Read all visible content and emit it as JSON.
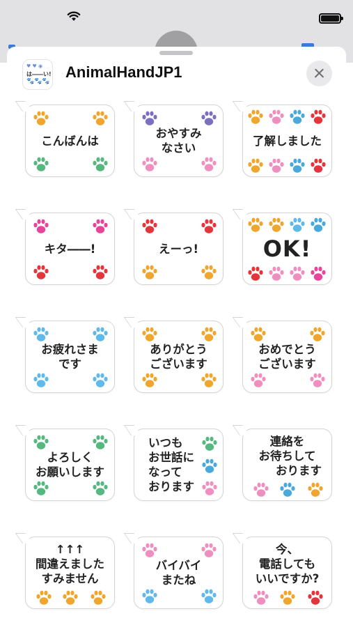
{
  "app": {
    "title": "AnimalHandJP1",
    "icon_line1": "♥ ♥ ◉",
    "icon_line2": "は――い!",
    "icon_line3": "🐾🐾🐾"
  },
  "colors": {
    "orange": "#f0a62d",
    "purple": "#7b6fc1",
    "pink": "#ee8fc0",
    "green": "#56b77f",
    "magenta": "#e8449a",
    "red": "#e4353c",
    "skyblue": "#5fb9ea",
    "teal": "#4aa9dc"
  },
  "stickers": [
    {
      "text": "こんばんは",
      "paws": [
        "orange",
        "orange",
        "green",
        "green"
      ],
      "layout": "corners"
    },
    {
      "text": "おやすみ\nなさい",
      "paws": [
        "purple",
        "purple",
        "pink",
        "pink"
      ],
      "layout": "corners"
    },
    {
      "text": "了解しました",
      "paws": [
        "orange",
        "pink",
        "teal",
        "red",
        "orange",
        "pink",
        "teal",
        "red"
      ],
      "layout": "rows4"
    },
    {
      "text": "キタ――!",
      "paws": [
        "magenta",
        "magenta",
        "red",
        "red"
      ],
      "layout": "corners"
    },
    {
      "text": "えーっ!",
      "paws": [
        "red",
        "red",
        "orange",
        "orange"
      ],
      "layout": "corners"
    },
    {
      "text": "OK!",
      "paws": [
        "orange",
        "orange",
        "skyblue",
        "teal",
        "red",
        "pink",
        "pink",
        "magenta"
      ],
      "layout": "rows4"
    },
    {
      "text": "お疲れさま\nです",
      "paws": [
        "skyblue",
        "skyblue",
        "skyblue",
        "skyblue"
      ],
      "layout": "corners"
    },
    {
      "text": "ありがとう\nございます",
      "paws": [
        "orange",
        "orange",
        "orange",
        "orange"
      ],
      "layout": "corners"
    },
    {
      "text": "おめでとう\nございます",
      "paws": [
        "orange",
        "orange",
        "pink",
        "pink"
      ],
      "layout": "corners"
    },
    {
      "text": "よろしく\nお願いします",
      "paws": [
        "green",
        "green",
        "green",
        "green"
      ],
      "layout": "corners"
    },
    {
      "text": "いつも\nお世話に\nなって\nおります",
      "paws": [
        "green",
        "teal",
        "pink"
      ],
      "layout": "rightcol"
    },
    {
      "text": "連絡を\nお待ちして\n　　おります",
      "paws": [
        "pink",
        "teal",
        "orange"
      ],
      "layout": "bottom3"
    },
    {
      "text": "↑↑↑\n間違えました\nすみません",
      "paws": [
        "orange",
        "orange",
        "orange"
      ],
      "layout": "bottom3"
    },
    {
      "text": "バイバイ\nまたね",
      "paws": [
        "pink",
        "pink",
        "skyblue",
        "skyblue"
      ],
      "layout": "corners"
    },
    {
      "text": "今、\n電話しても\nいいですか?",
      "paws": [
        "pink",
        "orange",
        "red"
      ],
      "layout": "bottom3"
    }
  ]
}
